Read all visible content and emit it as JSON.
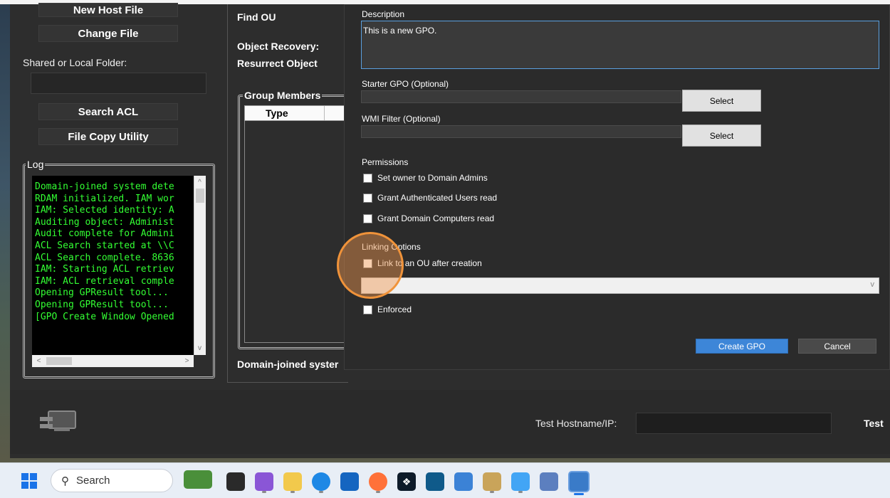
{
  "left_panel": {
    "new_host_file": "New Host File",
    "change_file": "Change File",
    "shared_folder_label": "Shared or Local Folder:",
    "search_acl": "Search ACL",
    "file_copy_utility": "File Copy Utility",
    "log_title": "Log",
    "log_lines": [
      "Domain-joined system dete",
      "RDAM initialized. IAM wor",
      "IAM: Selected identity: A",
      "Auditing object: Administ",
      "Audit complete for Admini",
      "ACL Search started at \\\\C",
      "ACL Search complete. 8636",
      "IAM: Starting ACL retriev",
      "IAM: ACL retrieval comple",
      "Opening GPResult tool...",
      "Opening GPResult tool...",
      "[GPO Create Window Opened"
    ]
  },
  "mid_panel": {
    "find_ou": "Find OU",
    "object_recovery": "Object Recovery:",
    "resurrect_object": "Resurrect Object",
    "group_members_title": "Group Members",
    "type_header": "Type",
    "status_text": "Domain-joined syster"
  },
  "dialog": {
    "description_label": "Description",
    "description_value": "This is a new GPO.",
    "starter_gpo_label": "Starter GPO (Optional)",
    "starter_select": "Select",
    "wmi_label": "WMI Filter (Optional)",
    "wmi_select": "Select",
    "permissions_label": "Permissions",
    "perm_owner": "Set owner to Domain Admins",
    "perm_auth_users": "Grant Authenticated Users read",
    "perm_domain_computers": "Grant Domain Computers read",
    "linking_label": "Linking Options",
    "link_ou": "Link to an OU after creation",
    "enforced": "Enforced",
    "create_gpo": "Create GPO",
    "cancel": "Cancel"
  },
  "bottom": {
    "test_label": "Test Hostname/IP:",
    "test_button": "Test"
  },
  "taskbar": {
    "search_placeholder": "Search"
  }
}
